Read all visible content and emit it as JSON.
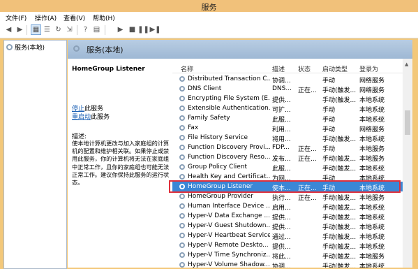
{
  "window": {
    "title": "服务"
  },
  "menu": [
    "文件(F)",
    "操作(A)",
    "查看(V)",
    "帮助(H)"
  ],
  "tree": {
    "root_label": "服务(本地)"
  },
  "header": {
    "title": "服务(本地)"
  },
  "details": {
    "service_name": "HomeGroup Listener",
    "stop_link": "停止",
    "stop_suffix": "此服务",
    "restart_link": "重启动",
    "restart_suffix": "此服务",
    "desc_label": "描述:",
    "desc_text": "使本地计算机更改与加入家庭组的计算机的配置和维护相关联。如果停止或禁用此服务，你的计算机将无法在家庭组中正常工作，且你的家庭组也可能无法正常工作。建议你保持此服务的运行状态。"
  },
  "columns": [
    "名称",
    "描述",
    "状态",
    "启动类型",
    "登录为"
  ],
  "rows": [
    {
      "name": "Distributed Transaction C...",
      "desc": "协调...",
      "status": "",
      "startup": "手动",
      "logon": "网络服务"
    },
    {
      "name": "DNS Client",
      "desc": "DNS...",
      "status": "正在...",
      "startup": "手动(触发...",
      "logon": "网络服务"
    },
    {
      "name": "Encrypting File System (E...",
      "desc": "提供...",
      "status": "",
      "startup": "手动(触发...",
      "logon": "本地系统"
    },
    {
      "name": "Extensible Authentication...",
      "desc": "可扩...",
      "status": "",
      "startup": "手动",
      "logon": "本地系统"
    },
    {
      "name": "Family Safety",
      "desc": "此服...",
      "status": "",
      "startup": "手动",
      "logon": "本地系统"
    },
    {
      "name": "Fax",
      "desc": "利用...",
      "status": "",
      "startup": "手动",
      "logon": "网络服务"
    },
    {
      "name": "File History Service",
      "desc": "将用...",
      "status": "",
      "startup": "手动(触发...",
      "logon": "本地系统"
    },
    {
      "name": "Function Discovery Provi...",
      "desc": "FDP...",
      "status": "正在...",
      "startup": "手动",
      "logon": "本地服务"
    },
    {
      "name": "Function Discovery Reso...",
      "desc": "发布...",
      "status": "正在...",
      "startup": "手动(触发...",
      "logon": "本地服务"
    },
    {
      "name": "Group Policy Client",
      "desc": "此服...",
      "status": "",
      "startup": "手动(触发...",
      "logon": "本地系统"
    },
    {
      "name": "Health Key and Certificat...",
      "desc": "为网...",
      "status": "",
      "startup": "手动",
      "logon": "本地系统"
    },
    {
      "name": "HomeGroup Listener",
      "desc": "使本...",
      "status": "正在...",
      "startup": "手动",
      "logon": "本地系统"
    },
    {
      "name": "HomeGroup Provider",
      "desc": "执行...",
      "status": "正在...",
      "startup": "手动(触发...",
      "logon": "本地服务"
    },
    {
      "name": "Human Interface Device ...",
      "desc": "启用...",
      "status": "",
      "startup": "手动(触发...",
      "logon": "本地系统"
    },
    {
      "name": "Hyper-V Data Exchange ...",
      "desc": "提供...",
      "status": "",
      "startup": "手动(触发...",
      "logon": "本地系统"
    },
    {
      "name": "Hyper-V Guest Shutdown...",
      "desc": "提供...",
      "status": "",
      "startup": "手动(触发...",
      "logon": "本地系统"
    },
    {
      "name": "Hyper-V Heartbeat Service",
      "desc": "通过...",
      "status": "",
      "startup": "手动(触发...",
      "logon": "本地系统"
    },
    {
      "name": "Hyper-V Remote Deskto...",
      "desc": "提供...",
      "status": "",
      "startup": "手动(触发...",
      "logon": "本地系统"
    },
    {
      "name": "Hyper-V Time Synchroniz...",
      "desc": "将此...",
      "status": "",
      "startup": "手动(触发...",
      "logon": "本地服务"
    },
    {
      "name": "Hyper-V Volume Shadow...",
      "desc": "协调...",
      "status": "",
      "startup": "手动(触发...",
      "logon": "本地系统"
    }
  ],
  "selected_index": 11
}
